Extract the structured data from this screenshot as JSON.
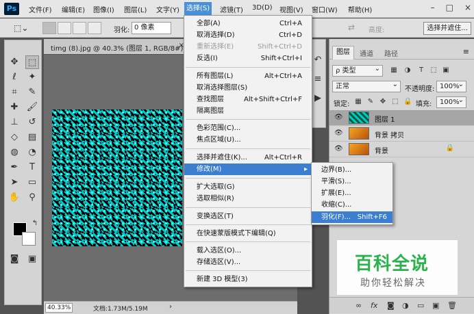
{
  "app": {
    "logo": "Ps"
  },
  "menubar": {
    "items": [
      "文件(F)",
      "编辑(E)",
      "图像(I)",
      "图层(L)",
      "文字(Y)",
      "选择(S)",
      "滤镜(T)",
      "3D(D)",
      "视图(V)",
      "窗口(W)",
      "帮助(H)"
    ],
    "active_index": 5,
    "window_controls": [
      "–",
      "□",
      "×"
    ]
  },
  "options": {
    "feather_label": "羽化:",
    "feather_value": "0 像素",
    "height_label": "高度:",
    "select_and_mask": "选择并遮住..."
  },
  "document": {
    "tab_title": "timg (8).jpg @ 40.3% (图层 1, RGB/8#) *",
    "tab_close": "×",
    "zoom": "40.33%",
    "doc_info": "文档:1.73M/5.19M",
    "status_arrow": "›"
  },
  "select_menu": {
    "items": [
      {
        "label": "全部(A)",
        "shortcut": "Ctrl+A"
      },
      {
        "label": "取消选择(D)",
        "shortcut": "Ctrl+D"
      },
      {
        "label": "重新选择(E)",
        "shortcut": "Shift+Ctrl+D",
        "disabled": true
      },
      {
        "label": "反选(I)",
        "shortcut": "Shift+Ctrl+I"
      },
      {
        "label": "所有图层(L)",
        "shortcut": "Alt+Ctrl+A"
      },
      {
        "label": "取消选择图层(S)",
        "shortcut": ""
      },
      {
        "label": "查找图层",
        "shortcut": "Alt+Shift+Ctrl+F"
      },
      {
        "label": "隔离图层",
        "shortcut": ""
      },
      {
        "label": "色彩范围(C)...",
        "shortcut": ""
      },
      {
        "label": "焦点区域(U)...",
        "shortcut": ""
      },
      {
        "label": "选择并遮住(K)...",
        "shortcut": "Alt+Ctrl+R"
      },
      {
        "label": "修改(M)",
        "shortcut": "▸"
      },
      {
        "label": "扩大选取(G)",
        "shortcut": ""
      },
      {
        "label": "选取相似(R)",
        "shortcut": ""
      },
      {
        "label": "变换选区(T)",
        "shortcut": ""
      },
      {
        "label": "在快速蒙版模式下编辑(Q)",
        "shortcut": ""
      },
      {
        "label": "载入选区(O)...",
        "shortcut": ""
      },
      {
        "label": "存储选区(V)...",
        "shortcut": ""
      },
      {
        "label": "新建 3D 模型(3)",
        "shortcut": ""
      }
    ]
  },
  "modify_submenu": {
    "items": [
      {
        "label": "边界(B)...",
        "shortcut": ""
      },
      {
        "label": "平滑(S)...",
        "shortcut": ""
      },
      {
        "label": "扩展(E)...",
        "shortcut": ""
      },
      {
        "label": "收缩(C)...",
        "shortcut": ""
      },
      {
        "label": "羽化(F)...",
        "shortcut": "Shift+F6"
      }
    ]
  },
  "layers_panel": {
    "tabs": [
      "图层",
      "通道",
      "路径"
    ],
    "kind_filter": "ρ 类型",
    "blend_mode": "正常",
    "opacity_label": "不透明度:",
    "opacity_value": "100%",
    "lock_label": "锁定:",
    "fill_label": "填充:",
    "fill_value": "100%",
    "layers": [
      {
        "name": "图层 1",
        "selected": true,
        "thumb": "teal"
      },
      {
        "name": "背景 拷贝",
        "selected": false,
        "thumb": "orange"
      },
      {
        "name": "背景",
        "selected": false,
        "thumb": "orange",
        "locked": true
      }
    ],
    "footer_icons": [
      "link-icon",
      "fx-icon",
      "mask-icon",
      "adjustment-icon",
      "group-icon",
      "new-layer-icon",
      "trash-icon"
    ]
  },
  "watermark": {
    "title": "百科全说",
    "subtitle": "助你轻松解决"
  }
}
